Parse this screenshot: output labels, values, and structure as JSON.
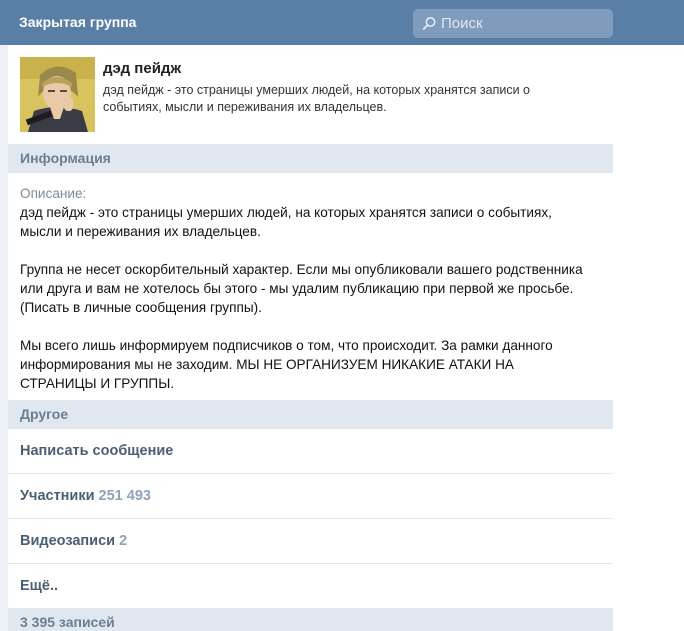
{
  "topbar": {
    "title": "Закрытая группа",
    "search_placeholder": "Поиск"
  },
  "group": {
    "name": "дэд пейдж",
    "short_description": "дэд пейдж - это страницы умерших людей, на которых хранятся записи о событиях, мысли и переживания их владельцев."
  },
  "info": {
    "header": "Информация",
    "description_label": "Описание:",
    "paragraphs": [
      "дэд пейдж - это страницы умерших людей, на которых хранятся записи о событиях, мысли и переживания их владельцев.",
      "Группа не несет оскорбительный характер. Если мы опубликовали вашего родственника или друга и вам не хотелось бы этого - мы удалим публикацию при первой же просьбе. (Писать в личные сообщения группы).",
      "Мы всего лишь информируем подписчиков о том, что происходит. За рамки данного информирования мы не заходим. МЫ НЕ ОРГАНИЗУЕМ НИКАКИЕ АТАКИ НА СТРАНИЦЫ И ГРУППЫ."
    ]
  },
  "other": {
    "header": "Другое",
    "write_message": "Написать сообщение",
    "members_label": "Участники",
    "members_count": "251 493",
    "videos_label": "Видеозаписи",
    "videos_count": "2",
    "more": "Ещё.."
  },
  "posts": {
    "header": "3 395 записей"
  },
  "colors": {
    "topbar": "#5a7fa6",
    "section_bg": "#e1e7ee",
    "link": "#4a5e74",
    "count": "#8fa3b8"
  }
}
